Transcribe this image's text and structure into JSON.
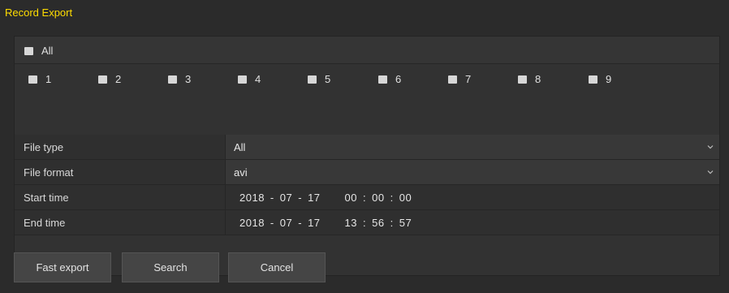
{
  "window": {
    "title": "Record Export"
  },
  "channels": {
    "all_label": "All",
    "items": [
      {
        "label": "1"
      },
      {
        "label": "2"
      },
      {
        "label": "3"
      },
      {
        "label": "4"
      },
      {
        "label": "5"
      },
      {
        "label": "6"
      },
      {
        "label": "7"
      },
      {
        "label": "8"
      },
      {
        "label": "9"
      }
    ]
  },
  "fields": {
    "file_type": {
      "label": "File type",
      "value": "All"
    },
    "file_format": {
      "label": "File format",
      "value": "avi"
    },
    "start_time": {
      "label": "Start time",
      "year": "2018",
      "month": "07",
      "day": "17",
      "hour": "00",
      "minute": "00",
      "second": "00"
    },
    "end_time": {
      "label": "End time",
      "year": "2018",
      "month": "07",
      "day": "17",
      "hour": "13",
      "minute": "56",
      "second": "57"
    },
    "date_sep": "-",
    "time_sep": ":"
  },
  "buttons": {
    "fast_export": "Fast export",
    "search": "Search",
    "cancel": "Cancel"
  },
  "colors": {
    "title": "#ffdd00",
    "background": "#2b2b2b",
    "checkbox": "#d7d7d7"
  },
  "icons": {
    "dropdown": "chevron-down-icon"
  }
}
